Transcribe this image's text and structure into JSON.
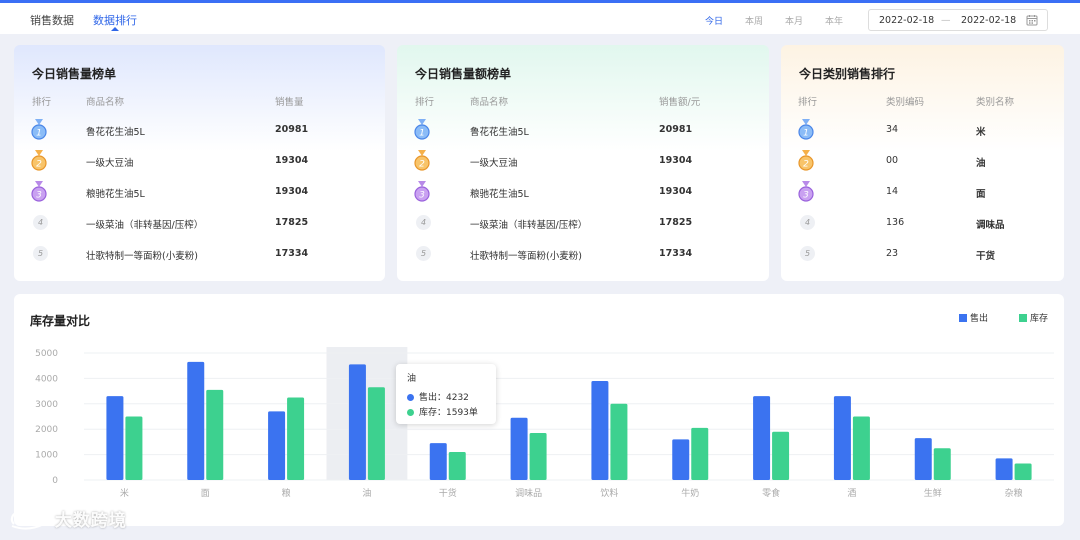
{
  "header": {
    "tabs": [
      {
        "label": "销售数据",
        "active": false
      },
      {
        "label": "数据排行",
        "active": true
      }
    ],
    "periods": [
      {
        "label": "今日",
        "active": true
      },
      {
        "label": "本周",
        "active": false
      },
      {
        "label": "本月",
        "active": false
      },
      {
        "label": "本年",
        "active": false
      }
    ],
    "date_range": {
      "start": "2022-02-18",
      "separator": "—",
      "end": "2022-02-18"
    }
  },
  "cards": [
    {
      "title": "今日销售量榜单",
      "columns": [
        "排行",
        "商品名称",
        "销售量"
      ],
      "rows": [
        {
          "rank": "1",
          "name": "鲁花花生油5L",
          "value": "20981"
        },
        {
          "rank": "2",
          "name": "一级大豆油",
          "value": "19304"
        },
        {
          "rank": "3",
          "name": "粮驰花生油5L",
          "value": "19304"
        },
        {
          "rank": "4",
          "name": "一级菜油（非转基因/压榨）",
          "value": "17825"
        },
        {
          "rank": "5",
          "name": "壮歌特制一等面粉(小麦粉)",
          "value": "17334"
        }
      ]
    },
    {
      "title": "今日销售量额榜单",
      "columns": [
        "排行",
        "商品名称",
        "销售额/元"
      ],
      "rows": [
        {
          "rank": "1",
          "name": "鲁花花生油5L",
          "value": "20981"
        },
        {
          "rank": "2",
          "name": "一级大豆油",
          "value": "19304"
        },
        {
          "rank": "3",
          "name": "粮驰花生油5L",
          "value": "19304"
        },
        {
          "rank": "4",
          "name": "一级菜油（非转基因/压榨）",
          "value": "17825"
        },
        {
          "rank": "5",
          "name": "壮歌特制一等面粉(小麦粉)",
          "value": "17334"
        }
      ]
    },
    {
      "title": "今日类别销售排行",
      "columns": [
        "排行",
        "类别编码",
        "类别名称"
      ],
      "rows": [
        {
          "rank": "1",
          "name": "34",
          "value": "米"
        },
        {
          "rank": "2",
          "name": "00",
          "value": "油"
        },
        {
          "rank": "3",
          "name": "14",
          "value": "面"
        },
        {
          "rank": "4",
          "name": "136",
          "value": "调味品"
        },
        {
          "rank": "5",
          "name": "23",
          "value": "干货"
        }
      ]
    }
  ],
  "chart_data": {
    "type": "bar",
    "title": "库存量对比",
    "categories": [
      "米",
      "面",
      "粮",
      "油",
      "干货",
      "调味品",
      "饮料",
      "牛奶",
      "零食",
      "酒",
      "生鲜",
      "杂粮"
    ],
    "series": [
      {
        "name": "售出",
        "color": "#3b73f0",
        "values": [
          3300,
          4650,
          2700,
          4550,
          1450,
          2450,
          3900,
          1600,
          3300,
          3300,
          1650,
          850
        ]
      },
      {
        "name": "库存",
        "color": "#3dd18f",
        "values": [
          2500,
          3550,
          3250,
          3650,
          1100,
          1850,
          3000,
          2050,
          1900,
          2500,
          1250,
          650
        ]
      }
    ],
    "ylim": [
      0,
      5000
    ],
    "yticks": [
      0,
      1000,
      2000,
      3000,
      4000,
      5000
    ],
    "legend": "top-right",
    "highlight_category": "油",
    "tooltip": {
      "title": "油",
      "items": [
        {
          "label": "售出：4232",
          "color": "#3b73f0"
        },
        {
          "label": "库存：1593单",
          "color": "#3dd18f"
        }
      ]
    }
  },
  "watermark": "大数跨境"
}
